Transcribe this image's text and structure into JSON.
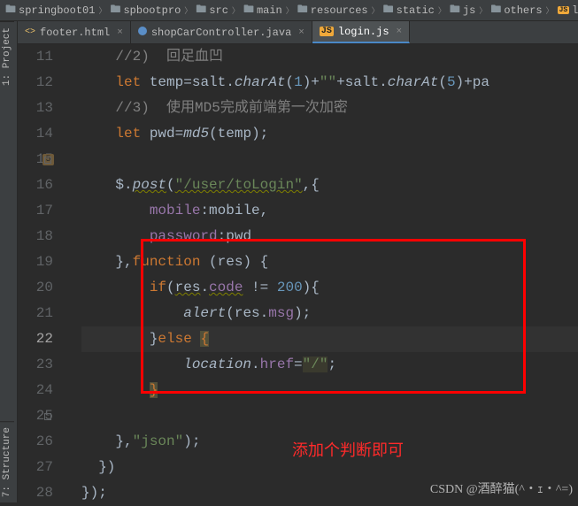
{
  "breadcrumb": [
    {
      "label": "springboot01",
      "icon": "folder"
    },
    {
      "label": "spbootpro",
      "icon": "folder"
    },
    {
      "label": "src",
      "icon": "folder"
    },
    {
      "label": "main",
      "icon": "folder"
    },
    {
      "label": "resources",
      "icon": "folder"
    },
    {
      "label": "static",
      "icon": "folder"
    },
    {
      "label": "js",
      "icon": "folder"
    },
    {
      "label": "others",
      "icon": "folder"
    },
    {
      "label": "login.js",
      "icon": "js"
    }
  ],
  "sidebarTabs": {
    "project": "1: Project",
    "structure": "7: Structure"
  },
  "tabs": [
    {
      "label": "footer.html",
      "icon": "html",
      "active": false
    },
    {
      "label": "shopCarController.java",
      "icon": "java",
      "active": false
    },
    {
      "label": "login.js",
      "icon": "js",
      "active": true
    }
  ],
  "gutter": {
    "lines": [
      11,
      12,
      13,
      14,
      15,
      16,
      17,
      18,
      19,
      20,
      21,
      22,
      23,
      24,
      25,
      26,
      27,
      28
    ],
    "current": 22,
    "bulbLine": 22,
    "breakpointLine": 15,
    "breakpointText": "5"
  },
  "code": {
    "tokens": {
      "let": "let",
      "temp": "temp",
      "eq": "=",
      "salt": "salt",
      "charAt": "charAt",
      "n1": "1",
      "plus": "+",
      "emptyStr": "\"\"",
      "n5": "5",
      "pa": "+pa",
      "comment3": "//3)  使用MD5完成前端第一次加密",
      "pwd": "pwd",
      "md5": "md5",
      "lp": "(",
      "rp": ")",
      "semi": ";",
      "dollar": "$",
      "post": "post",
      "urlLogin": "\"/user/toLogin\"",
      "comma": ",",
      "lbrace": "{",
      "rbrace": "}",
      "mobileK": "mobile",
      "colon": ":",
      "mobileV": "mobile",
      "passwordK": "password",
      "function": "function",
      "res": "res",
      "if": "if",
      "code": "code",
      "neq": " != ",
      "n200": "200",
      "alert": "alert",
      "msg": "msg",
      "else": "else",
      "location": "location",
      "href": "href",
      "rootStr": "\"/\"",
      "json": "\"json\"",
      "rparen_semi": ");",
      "c27": "})",
      "c28": "});"
    }
  },
  "annotation": "添加个判断即可",
  "watermark": "CSDN @酒醉猫(^・ｪ・^=)"
}
